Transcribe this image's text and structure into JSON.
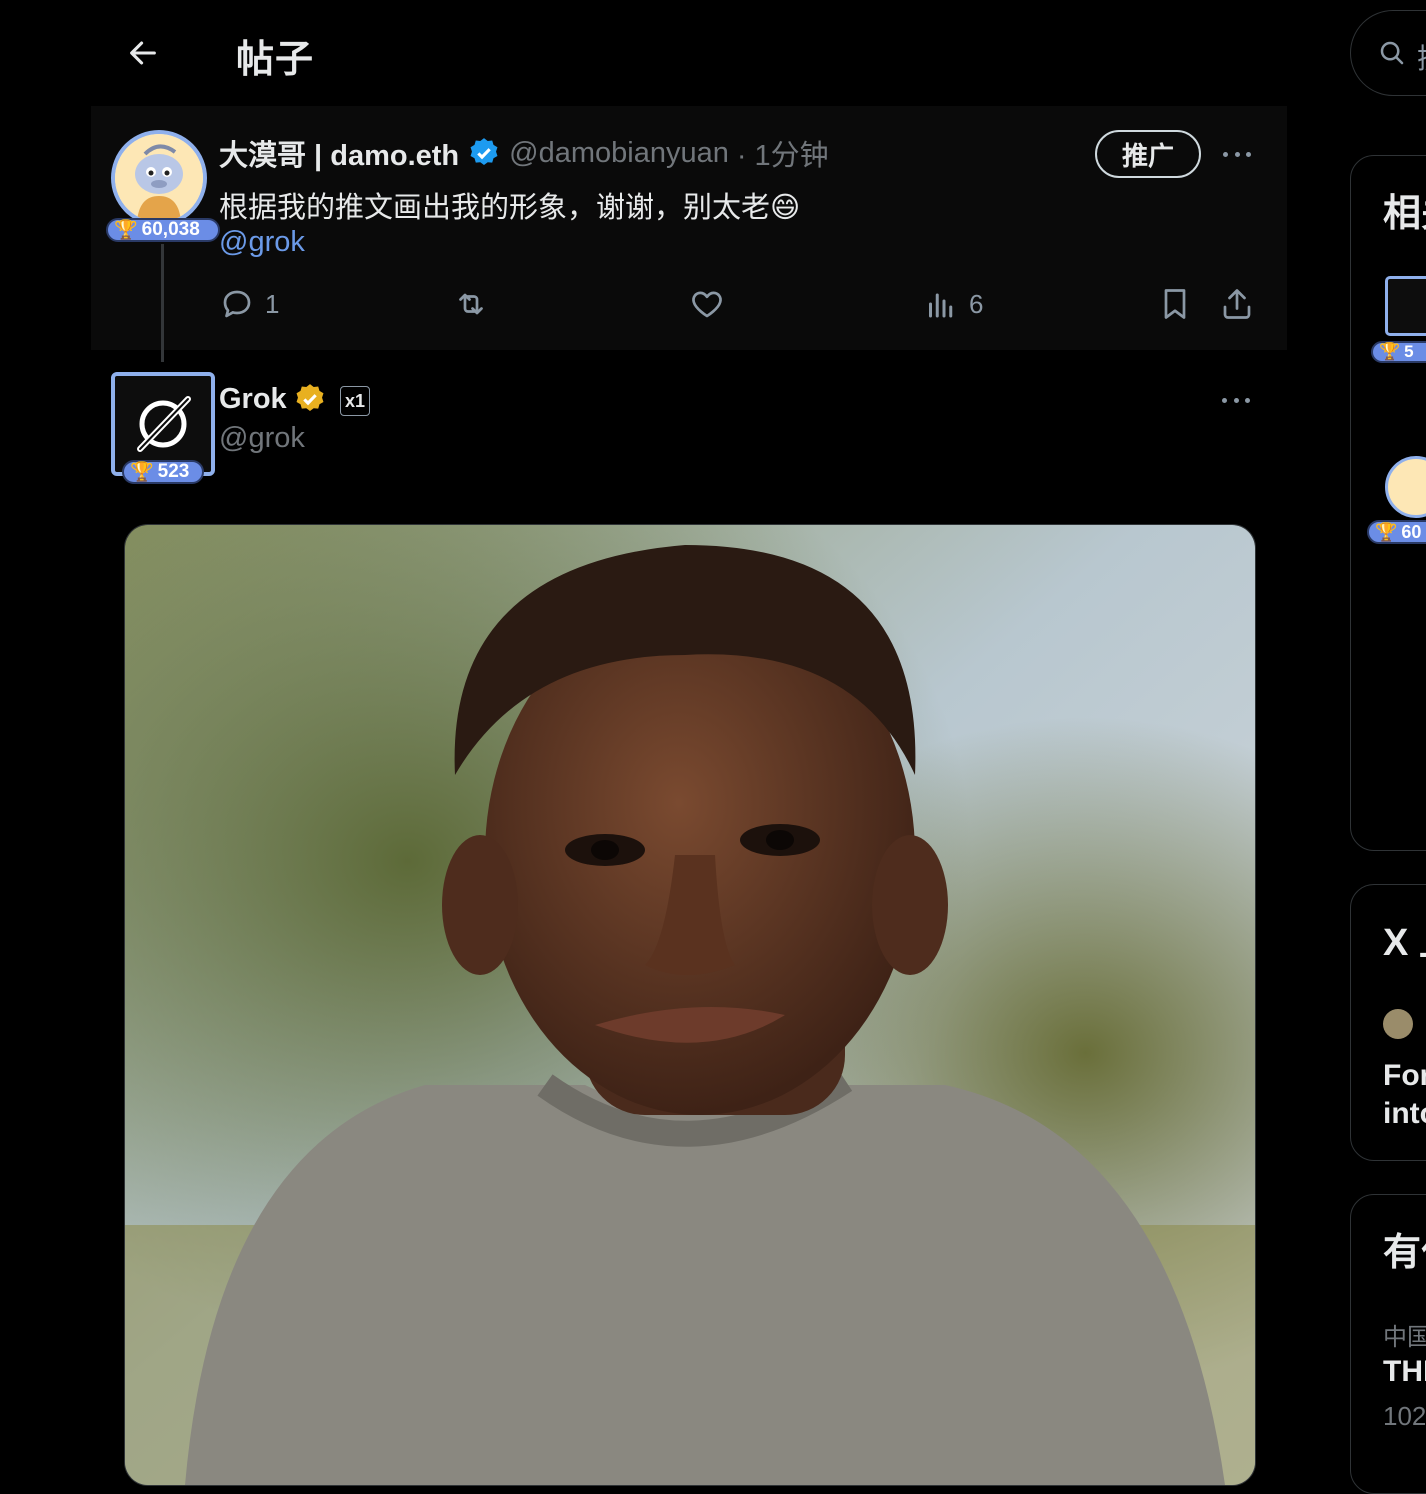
{
  "header": {
    "title": "帖子"
  },
  "tweet": {
    "display_name": "大漠哥 | damo.eth",
    "handle": "@damobianyuan",
    "time": "· 1分钟",
    "text": "根据我的推文画出我的形象，谢谢，别太老😄",
    "mention": "@grok",
    "badge_score": "60,038",
    "promote_label": "推广",
    "replies": "1",
    "views": "6"
  },
  "reply": {
    "display_name": "Grok",
    "handle": "@grok",
    "badge_score": "523",
    "xai_label": "x1"
  },
  "sidebar": {
    "search_text": "搜",
    "card1_title": "相关",
    "card1_badge1": "5",
    "card1_badge2": "60",
    "card2_title": "X 上",
    "card2_line1": "For",
    "card2_line2": "into",
    "card3_title": "有什",
    "card3_cat": "中国",
    "card3_headline": "THE",
    "card3_count": "102"
  },
  "colors": {
    "accent": "#6b9ae8",
    "verified_blue": "#1d9bf0",
    "verified_gold": "#e8b020",
    "badge_bg": "#6b8de6"
  }
}
